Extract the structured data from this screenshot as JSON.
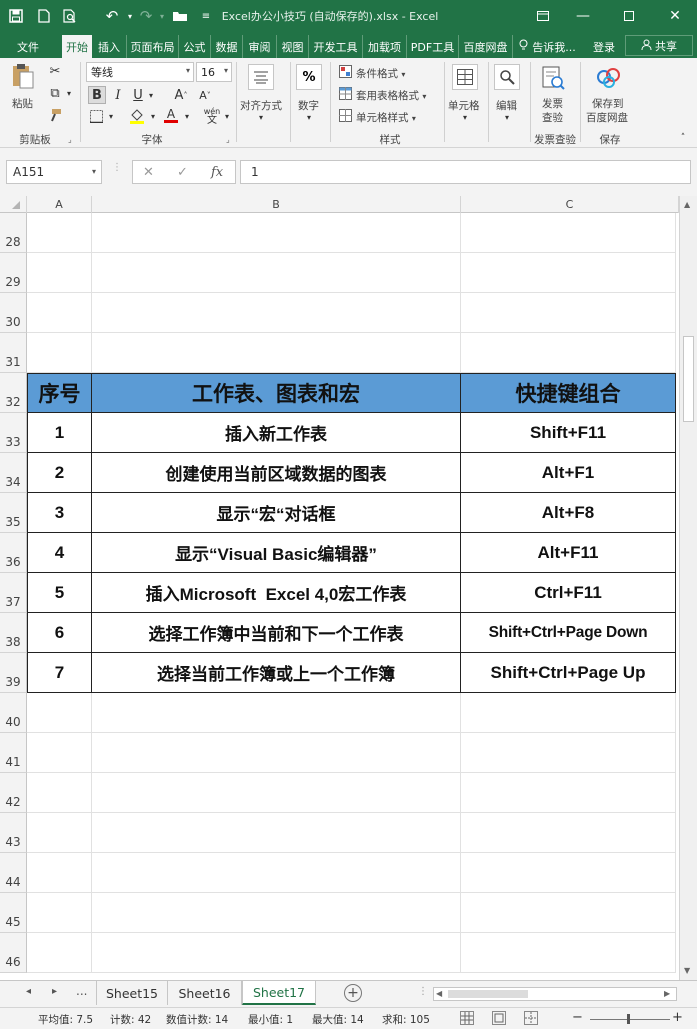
{
  "window": {
    "title": "Excel办公小技巧 (自动保存的).xlsx - Excel",
    "brand_color": "#217346"
  },
  "quick_access": [
    "save-icon",
    "new-file-icon",
    "print-preview-icon",
    "undo-icon",
    "redo-icon",
    "open-folder-icon",
    "customize-icon"
  ],
  "tabs": [
    {
      "label": "文件"
    },
    {
      "label": "开始",
      "active": true
    },
    {
      "label": "插入"
    },
    {
      "label": "页面布局"
    },
    {
      "label": "公式"
    },
    {
      "label": "数据"
    },
    {
      "label": "审阅"
    },
    {
      "label": "视图"
    },
    {
      "label": "开发工具"
    },
    {
      "label": "加载项"
    },
    {
      "label": "PDF工具"
    },
    {
      "label": "百度网盘"
    }
  ],
  "tellme": "告诉我...",
  "login": "登录",
  "share": "共享",
  "ribbon": {
    "clipboard": {
      "paste": "粘贴",
      "group": "剪贴板"
    },
    "font": {
      "name": "等线",
      "size": "16",
      "group": "字体",
      "bold": "B",
      "italic": "I",
      "underline": "U",
      "grow": "A",
      "shrink": "A",
      "font_color_letter": "A",
      "phonetic": "wén"
    },
    "alignment": {
      "label": "对齐方式"
    },
    "number": {
      "label": "数字",
      "icon_text": "%"
    },
    "styles": {
      "cond": "条件格式",
      "table": "套用表格格式",
      "cell": "单元格样式",
      "group": "样式"
    },
    "cells": {
      "label": "单元格"
    },
    "editing": {
      "label": "编辑"
    },
    "invoice": {
      "line1": "发票",
      "line2": "查验",
      "group": "发票查验"
    },
    "save": {
      "line1": "保存到",
      "line2": "百度网盘",
      "group": "保存"
    }
  },
  "formula_bar": {
    "name_box": "A151",
    "cancel": "✕",
    "enter": "✓",
    "fx": "fx",
    "value": "1"
  },
  "columns": [
    "A",
    "B",
    "C"
  ],
  "sheet": {
    "empty_rows_top": [
      "28",
      "29",
      "30",
      "31"
    ],
    "header_row": {
      "row": "32",
      "a": "序号",
      "b": "工作表、图表和宏",
      "c": "快捷键组合"
    },
    "data_rows": [
      {
        "row": "33",
        "a": "1",
        "b": "插入新工作表",
        "c": "Shift+F11"
      },
      {
        "row": "34",
        "a": "2",
        "b": "创建使用当前区域数据的图表",
        "c": "Alt+F1"
      },
      {
        "row": "35",
        "a": "3",
        "b": "显示“宏“对话框",
        "c": "Alt+F8"
      },
      {
        "row": "36",
        "a": "4",
        "b": "显示“Visual Basic编辑器”",
        "c": "Alt+F11"
      },
      {
        "row": "37",
        "a": "5",
        "b": "插入Microsoft  Excel 4,0宏工作表",
        "c": "Ctrl+F11"
      },
      {
        "row": "38",
        "a": "6",
        "b": "选择工作簿中当前和下一个工作表",
        "c": "Shift+Ctrl+Page Down"
      },
      {
        "row": "39",
        "a": "7",
        "b": "选择当前工作簿或上一个工作簿",
        "c": "Shift+Ctrl+Page Up"
      }
    ],
    "empty_rows_bottom": [
      "40",
      "41",
      "42",
      "43",
      "44",
      "45",
      "46"
    ],
    "header_fill": "#5b9bd5"
  },
  "sheet_tabs": {
    "more": "...",
    "tabs": [
      {
        "label": "Sheet15"
      },
      {
        "label": "Sheet16"
      },
      {
        "label": "Sheet17",
        "active": true
      }
    ],
    "add": "+"
  },
  "status": {
    "avg": "平均值: 7.5",
    "count": "计数: 42",
    "numcount": "数值计数: 14",
    "min": "最小值: 1",
    "max": "最大值: 14",
    "sum": "求和: 105",
    "zoom_minus": "−",
    "zoom_plus": "+"
  }
}
